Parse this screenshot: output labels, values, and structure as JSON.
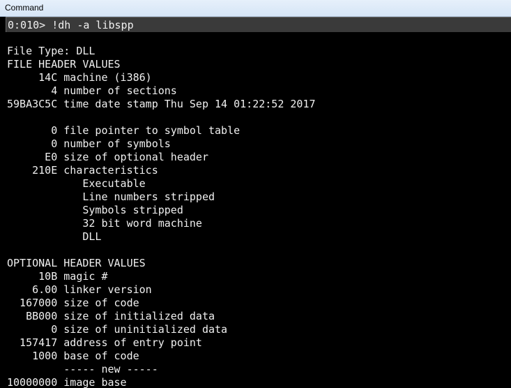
{
  "window": {
    "title": "Command"
  },
  "command": {
    "prompt_line": "0:010> !dh -a libspp"
  },
  "output": [
    "File Type: DLL",
    "FILE HEADER VALUES",
    "     14C machine (i386)",
    "       4 number of sections",
    "59BA3C5C time date stamp Thu Sep 14 01:22:52 2017",
    "",
    "       0 file pointer to symbol table",
    "       0 number of symbols",
    "      E0 size of optional header",
    "    210E characteristics",
    "            Executable",
    "            Line numbers stripped",
    "            Symbols stripped",
    "            32 bit word machine",
    "            DLL",
    "",
    "OPTIONAL HEADER VALUES",
    "     10B magic #",
    "    6.00 linker version",
    "  167000 size of code",
    "   BB000 size of initialized data",
    "       0 size of uninitialized data",
    "  157417 address of entry point",
    "    1000 base of code",
    "         ----- new -----",
    "10000000 image base"
  ]
}
